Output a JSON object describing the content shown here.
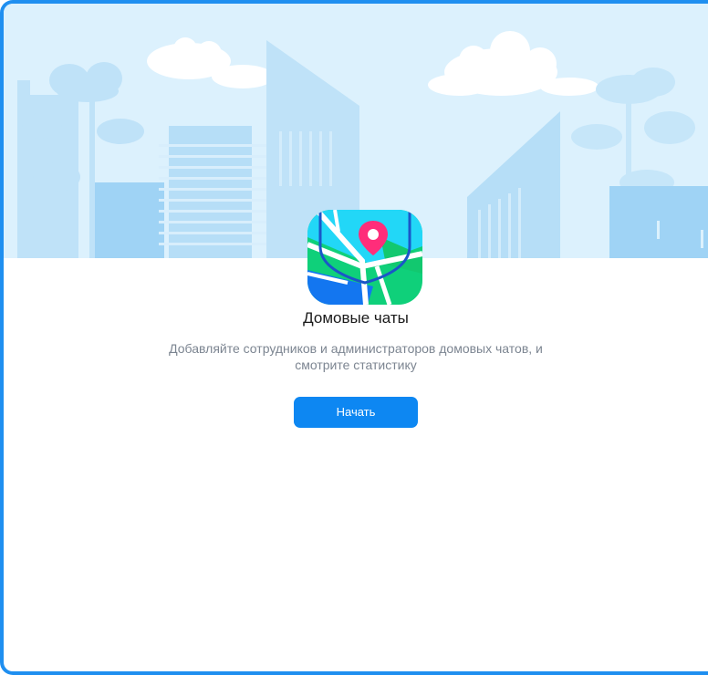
{
  "hero": {
    "illustration": "city-skyline-illustration",
    "icon": "map-pin-icon"
  },
  "content": {
    "title": "Домовые чаты",
    "subtitle": "Добавляйте сотрудников и администраторов домовых чатов, и смотрите статистику",
    "start_label": "Начать"
  },
  "colors": {
    "border": "#1f8ff0",
    "sky": "#dcf1fd",
    "accent": "#0d87f2",
    "pin": "#ff2d7a"
  }
}
